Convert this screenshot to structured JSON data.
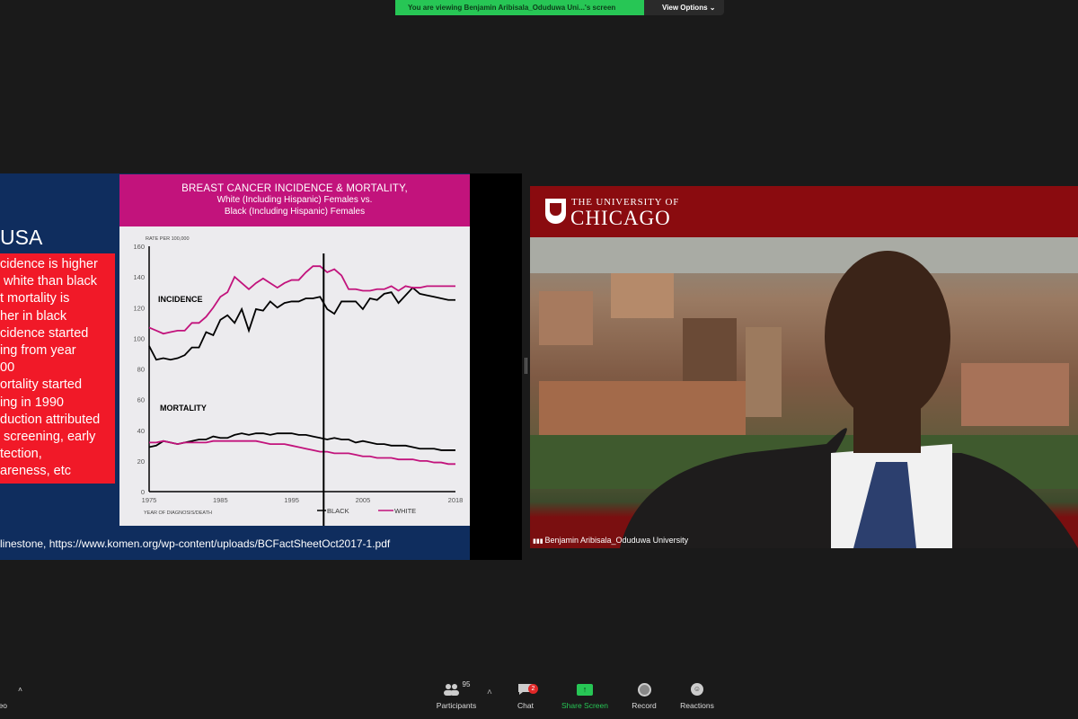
{
  "zoom": {
    "viewing_banner": "You are viewing Benjamin Aribisala_Oduduwa Uni...'s screen",
    "view_options": "View Options ⌄",
    "toolbar": [
      {
        "label": "Participants",
        "count": "95",
        "icon": "participants-icon"
      },
      {
        "label": "Chat",
        "badge": "2",
        "icon": "chat-icon"
      },
      {
        "label": "Share Screen",
        "icon": "share-screen-icon",
        "color": "#27c655"
      },
      {
        "label": "Record",
        "icon": "record-icon"
      },
      {
        "label": "Reactions",
        "icon": "reactions-icon"
      }
    ],
    "left_partial_label": "ideo",
    "participant_name": "Benjamin Aribisala_Oduduwa University",
    "video_banner": {
      "line1": "THE UNIVERSITY OF",
      "line2": "CHICAGO"
    }
  },
  "slide": {
    "heading": "USA",
    "bullets": "cidence is higher\n white than black\nt mortality is\nher in black\ncidence started\ning from year\n00\nortality started\ning in 1990\nduction attributed\n screening, early\ntection,\nareness, etc",
    "footer": "linestone, https://www.komen.org/wp-content/uploads/BCFactSheetOct2017-1.pdf"
  },
  "chart_data": {
    "type": "line",
    "title": "BREAST CANCER INCIDENCE & MORTALITY,",
    "subtitle": [
      "White (Including Hispanic) Females vs.",
      "Black (Including Hispanic) Females"
    ],
    "ylabel": "RATE PER 100,000",
    "xlabel": "YEAR OF DIAGNOSIS/DEATH",
    "ylim": [
      0,
      160
    ],
    "yticks": [
      "0",
      "20",
      "40",
      "60",
      "80",
      "100",
      "120",
      "140",
      "160"
    ],
    "xlim": [
      1975,
      2018
    ],
    "xticks": [
      "1975",
      "1985",
      "1995",
      "2005",
      "2018"
    ],
    "annotations": [
      "INCIDENCE",
      "MORTALITY"
    ],
    "legend": [
      {
        "name": "BLACK",
        "color": "#000000"
      },
      {
        "name": "WHITE",
        "color": "#c2137c"
      }
    ],
    "vertical_marker_year": 1999.5,
    "x_start": 1975,
    "series": [
      {
        "name": "BLACK",
        "group": "INCIDENCE",
        "color": "#000000",
        "values": [
          95,
          86,
          87,
          86,
          87,
          89,
          94,
          94,
          104,
          102,
          112,
          115,
          110,
          119,
          105,
          119,
          118,
          124,
          120,
          123,
          124,
          124,
          126,
          126,
          127,
          119,
          116,
          124,
          124,
          124,
          119,
          126,
          125,
          129,
          130,
          123,
          128,
          133,
          129,
          128,
          127,
          126,
          125,
          125
        ]
      },
      {
        "name": "WHITE",
        "group": "INCIDENCE",
        "color": "#c2137c",
        "values": [
          107,
          105,
          103,
          104,
          105,
          105,
          110,
          110,
          114,
          120,
          127,
          130,
          140,
          136,
          132,
          136,
          139,
          136,
          133,
          136,
          138,
          138,
          143,
          147,
          147,
          143,
          145,
          141,
          132,
          132,
          131,
          131,
          132,
          132,
          134,
          131,
          134,
          133,
          133,
          134,
          134,
          134,
          134,
          134
        ]
      },
      {
        "name": "BLACK",
        "group": "MORTALITY",
        "color": "#000000",
        "values": [
          29,
          30,
          33,
          32,
          31,
          32,
          33,
          34,
          34,
          36,
          35,
          35,
          37,
          38,
          37,
          38,
          38,
          37,
          38,
          38,
          38,
          37,
          37,
          36,
          35,
          34,
          35,
          34,
          34,
          32,
          33,
          32,
          31,
          31,
          30,
          30,
          30,
          29,
          28,
          28,
          28,
          27,
          27,
          27
        ]
      },
      {
        "name": "WHITE",
        "group": "MORTALITY",
        "color": "#c2137c",
        "values": [
          32,
          32,
          33,
          32,
          31,
          32,
          32,
          32,
          32,
          33,
          33,
          33,
          33,
          33,
          33,
          33,
          32,
          31,
          31,
          31,
          30,
          29,
          28,
          27,
          26,
          26,
          25,
          25,
          25,
          24,
          23,
          23,
          22,
          22,
          22,
          21,
          21,
          21,
          20,
          20,
          19,
          19,
          18,
          18
        ]
      }
    ]
  }
}
